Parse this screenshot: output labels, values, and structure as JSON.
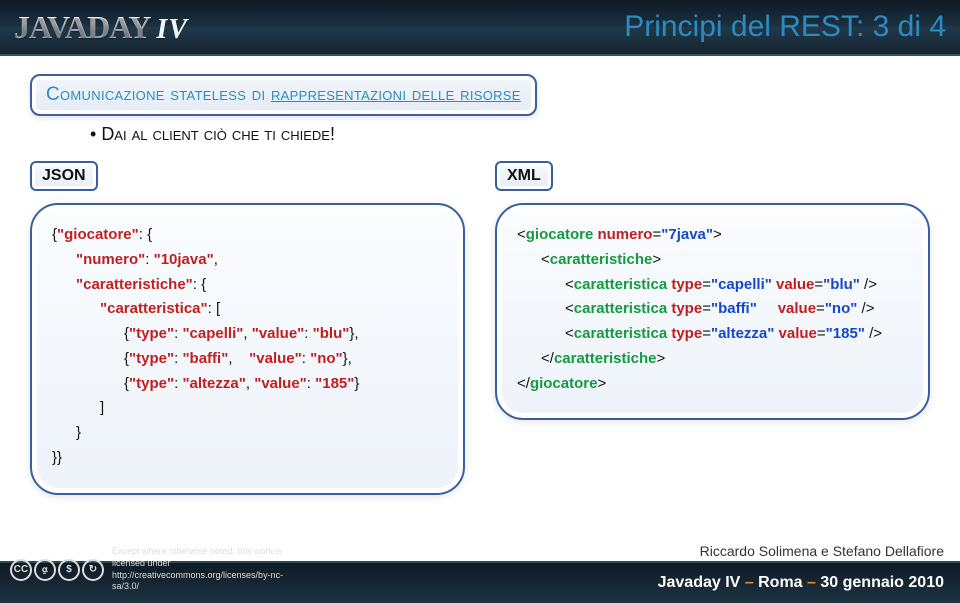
{
  "header": {
    "logo_main": "JAVADAY",
    "logo_sub": "IV",
    "page_title": "Principi del REST: 3 di 4"
  },
  "pill": {
    "prefix": "Comunicazione stateless di ",
    "underlined": "rappresentazioni delle risorse"
  },
  "bullet": "Dai al client ciò che ti chiede!",
  "json_panel": {
    "tag": "JSON",
    "lines": [
      {
        "cls": "",
        "html": "{<span class='r'>\"giocatore\"</span>: {"
      },
      {
        "cls": "ind1",
        "html": "<span class='r'>\"numero\"</span>: <span class='r'>\"10java\"</span>,"
      },
      {
        "cls": "ind1",
        "html": "<span class='r'>\"caratteristiche\"</span>: {"
      },
      {
        "cls": "ind2",
        "html": "<span class='r'>\"caratteristica\"</span>: ["
      },
      {
        "cls": "ind3",
        "html": "{<span class='r'>\"type\"</span>: <span class='r'>\"capelli\"</span>, <span class='r'>\"value\"</span>: <span class='r'>\"blu\"</span>},"
      },
      {
        "cls": "ind3",
        "html": "{<span class='r'>\"type\"</span>: <span class='r'>\"baffi\"</span>,&nbsp;&nbsp;&nbsp;&nbsp;<span class='r'>\"value\"</span>: <span class='r'>\"no\"</span>},"
      },
      {
        "cls": "ind3",
        "html": "{<span class='r'>\"type\"</span>: <span class='r'>\"altezza\"</span>, <span class='r'>\"value\"</span>: <span class='r'>\"185\"</span>}"
      },
      {
        "cls": "ind2",
        "html": "]"
      },
      {
        "cls": "ind1",
        "html": "}"
      },
      {
        "cls": "",
        "html": "}}"
      }
    ]
  },
  "xml_panel": {
    "tag": "XML",
    "lines": [
      {
        "cls": "",
        "html": "&lt;<span class='g'>giocatore</span> <span class='a'>numero</span>=<span class='bl'>\"7java\"</span>&gt;"
      },
      {
        "cls": "ind1",
        "html": "&lt;<span class='g'>caratteristiche</span>&gt;"
      },
      {
        "cls": "ind2",
        "html": "&lt;<span class='g'>caratteristica</span> <span class='a'>type</span>=<span class='bl'>\"capelli\"</span>&nbsp;<span class='a'>value</span>=<span class='bl'>\"blu\"</span> /&gt;"
      },
      {
        "cls": "ind2",
        "html": "&lt;<span class='g'>caratteristica</span> <span class='a'>type</span>=<span class='bl'>\"baffi\"</span>&nbsp;&nbsp;&nbsp;&nbsp;&nbsp;<span class='a'>value</span>=<span class='bl'>\"no\"</span> /&gt;"
      },
      {
        "cls": "ind2",
        "html": "&lt;<span class='g'>caratteristica</span> <span class='a'>type</span>=<span class='bl'>\"altezza\"</span>&nbsp;<span class='a'>value</span>=<span class='bl'>\"185\"</span> /&gt;"
      },
      {
        "cls": "ind1",
        "html": "&lt;/<span class='g'>caratteristiche</span>&gt;"
      },
      {
        "cls": "",
        "html": "&lt;/<span class='g'>giocatore</span>&gt;"
      }
    ]
  },
  "footer": {
    "cc_line1": "Except where otherwise noted, this work is licensed under",
    "cc_line2": "http://creativecommons.org/licenses/by-nc-sa/3.0/",
    "authors": "Riccardo Solimena e Stefano Dellafiore",
    "event_name": "Javaday IV",
    "event_sep": " – ",
    "event_place": "Roma",
    "event_date": "30 gennaio 2010"
  }
}
